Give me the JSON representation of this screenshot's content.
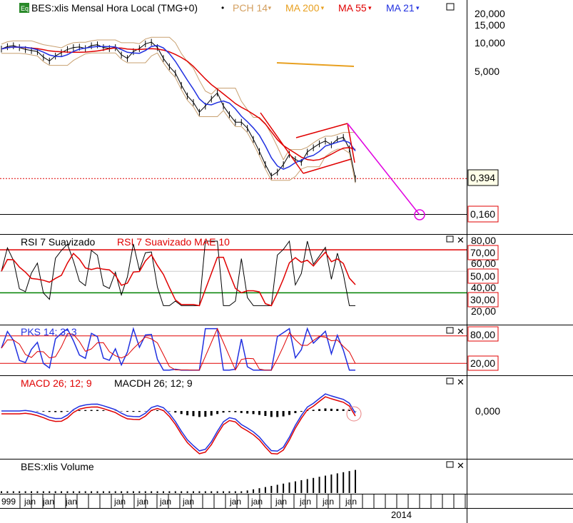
{
  "header": {
    "badge": "Eq",
    "title": "BES:xlis Mensal Hora Local (TMG+0)",
    "indicators": [
      {
        "label": "PCH 14",
        "color": "#d4a060"
      },
      {
        "label": "MA 200",
        "color": "#e8a020"
      },
      {
        "label": "MA 55",
        "color": "#e00000"
      },
      {
        "label": "MA 21",
        "color": "#2030e0"
      }
    ]
  },
  "price_axis": {
    "ticks": [
      "20,000",
      "15,000",
      "10,000",
      "5,000"
    ],
    "last_price": "0,394",
    "target_price": "0,160"
  },
  "rsi_panel": {
    "title": "RSI 7 Suavizado",
    "ma_title": "RSI 7 Suavizado MAE 10",
    "ticks": [
      "80,00",
      "60,00",
      "40,00",
      "20,00"
    ],
    "levels": [
      "70,00",
      "50,00",
      "30,00"
    ]
  },
  "pks_panel": {
    "title": "PKS 14; 3; 3",
    "levels": [
      "80,00",
      "20,00"
    ]
  },
  "macd_panel": {
    "title": "MACD 26; 12; 9",
    "hist_title": "MACDH 26; 12; 9",
    "zero": "0,000"
  },
  "volume_panel": {
    "title": "BES:xlis Volume"
  },
  "time_axis": {
    "first": "999",
    "labels": [
      "jan",
      "jan",
      "jan",
      "jan",
      "jan",
      "jan",
      "jan",
      "jan",
      "jan",
      "jan",
      "jan",
      "jan",
      "jan",
      "jan"
    ],
    "year": "2014"
  },
  "colors": {
    "ma21": "#2030e0",
    "ma55": "#e00000",
    "pch": "#c8a070",
    "projection": "#e000e0",
    "rsi_upper": "#e00000",
    "rsi_lower": "#008000"
  },
  "chart_data": {
    "type": "line",
    "title": "BES:xlis Mensal Hora Local (TMG+0)",
    "y_scale": "log",
    "ylim": [
      0.15,
      25
    ],
    "grid": false,
    "price": [
      8.5,
      9.0,
      9.2,
      8.8,
      8.4,
      8.2,
      8.0,
      7.0,
      6.4,
      7.2,
      7.8,
      8.4,
      8.8,
      8.9,
      8.6,
      9.2,
      9.4,
      8.8,
      8.6,
      8.8,
      7.4,
      6.8,
      8.0,
      8.6,
      9.6,
      10.0,
      8.8,
      6.8,
      5.6,
      4.8,
      3.6,
      2.8,
      2.4,
      1.9,
      2.2,
      2.6,
      3.0,
      2.2,
      1.8,
      1.5,
      1.5,
      1.3,
      1.0,
      0.75,
      0.55,
      0.42,
      0.46,
      0.55,
      0.7,
      0.62,
      0.58,
      0.74,
      0.82,
      0.9,
      0.96,
      0.88,
      1.0,
      1.05,
      0.8,
      0.394
    ],
    "last_price": 0.394,
    "target_price": 0.16,
    "rsi_levels": [
      70,
      50,
      30
    ],
    "pks_levels": [
      80,
      20
    ]
  }
}
